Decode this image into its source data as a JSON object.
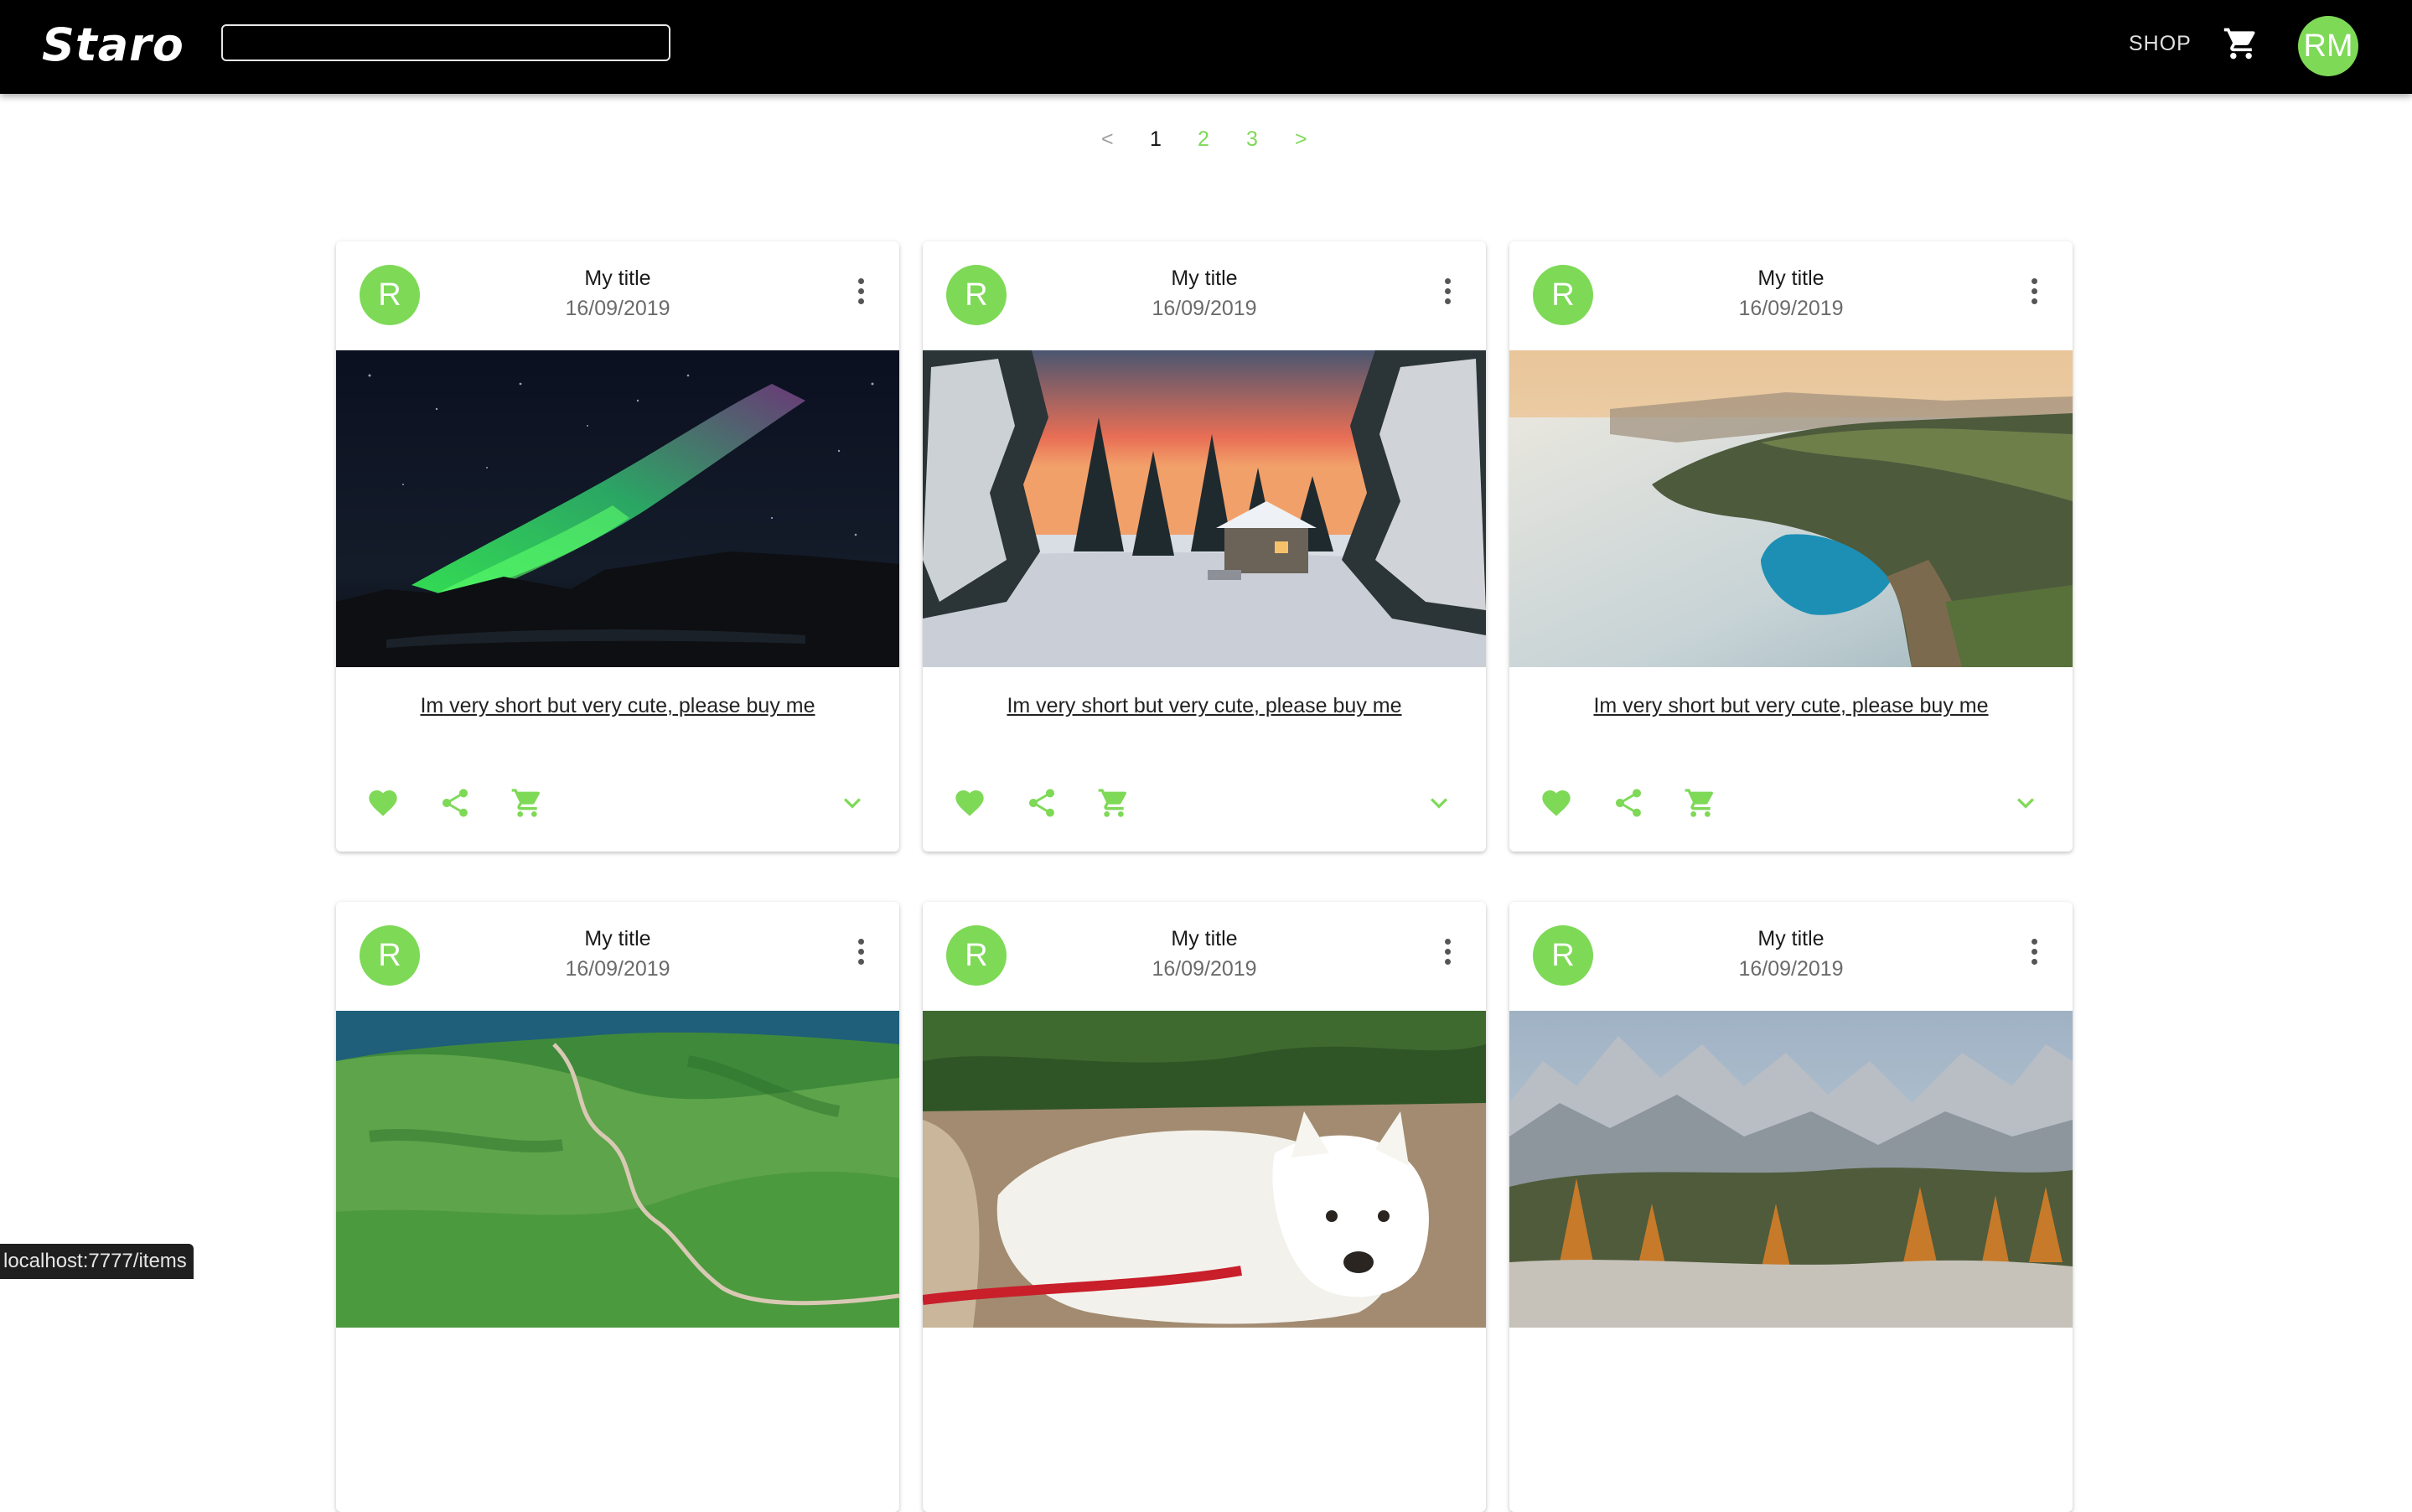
{
  "header": {
    "logo": "Staro",
    "search_value": "",
    "shop_label": "SHOP",
    "cart_icon": "cart-icon",
    "user_initials": "RM"
  },
  "pagination": {
    "prev": "<",
    "pages": [
      "1",
      "2",
      "3"
    ],
    "current": "1",
    "next": ">"
  },
  "accent_color": "#7ed957",
  "cards": [
    {
      "avatar": "R",
      "title": "My title",
      "date": "16/09/2019",
      "description": "Im very short but very cute, please buy me",
      "image": "aurora-night-sky"
    },
    {
      "avatar": "R",
      "title": "My title",
      "date": "16/09/2019",
      "description": "Im very short but very cute, please buy me",
      "image": "snowy-cabin-sunset"
    },
    {
      "avatar": "R",
      "title": "My title",
      "date": "16/09/2019",
      "description": "Im very short but very cute, please buy me",
      "image": "coastal-cliffs"
    },
    {
      "avatar": "R",
      "title": "My title",
      "date": "16/09/2019",
      "description": "",
      "image": "green-hills-road"
    },
    {
      "avatar": "R",
      "title": "My title",
      "date": "16/09/2019",
      "description": "",
      "image": "white-dog-resting"
    },
    {
      "avatar": "R",
      "title": "My title",
      "date": "16/09/2019",
      "description": "",
      "image": "autumn-mountains"
    }
  ],
  "card_actions": [
    "favorite-icon",
    "share-icon",
    "add-to-cart-icon",
    "expand-icon"
  ],
  "status_bar": "localhost:7777/items"
}
